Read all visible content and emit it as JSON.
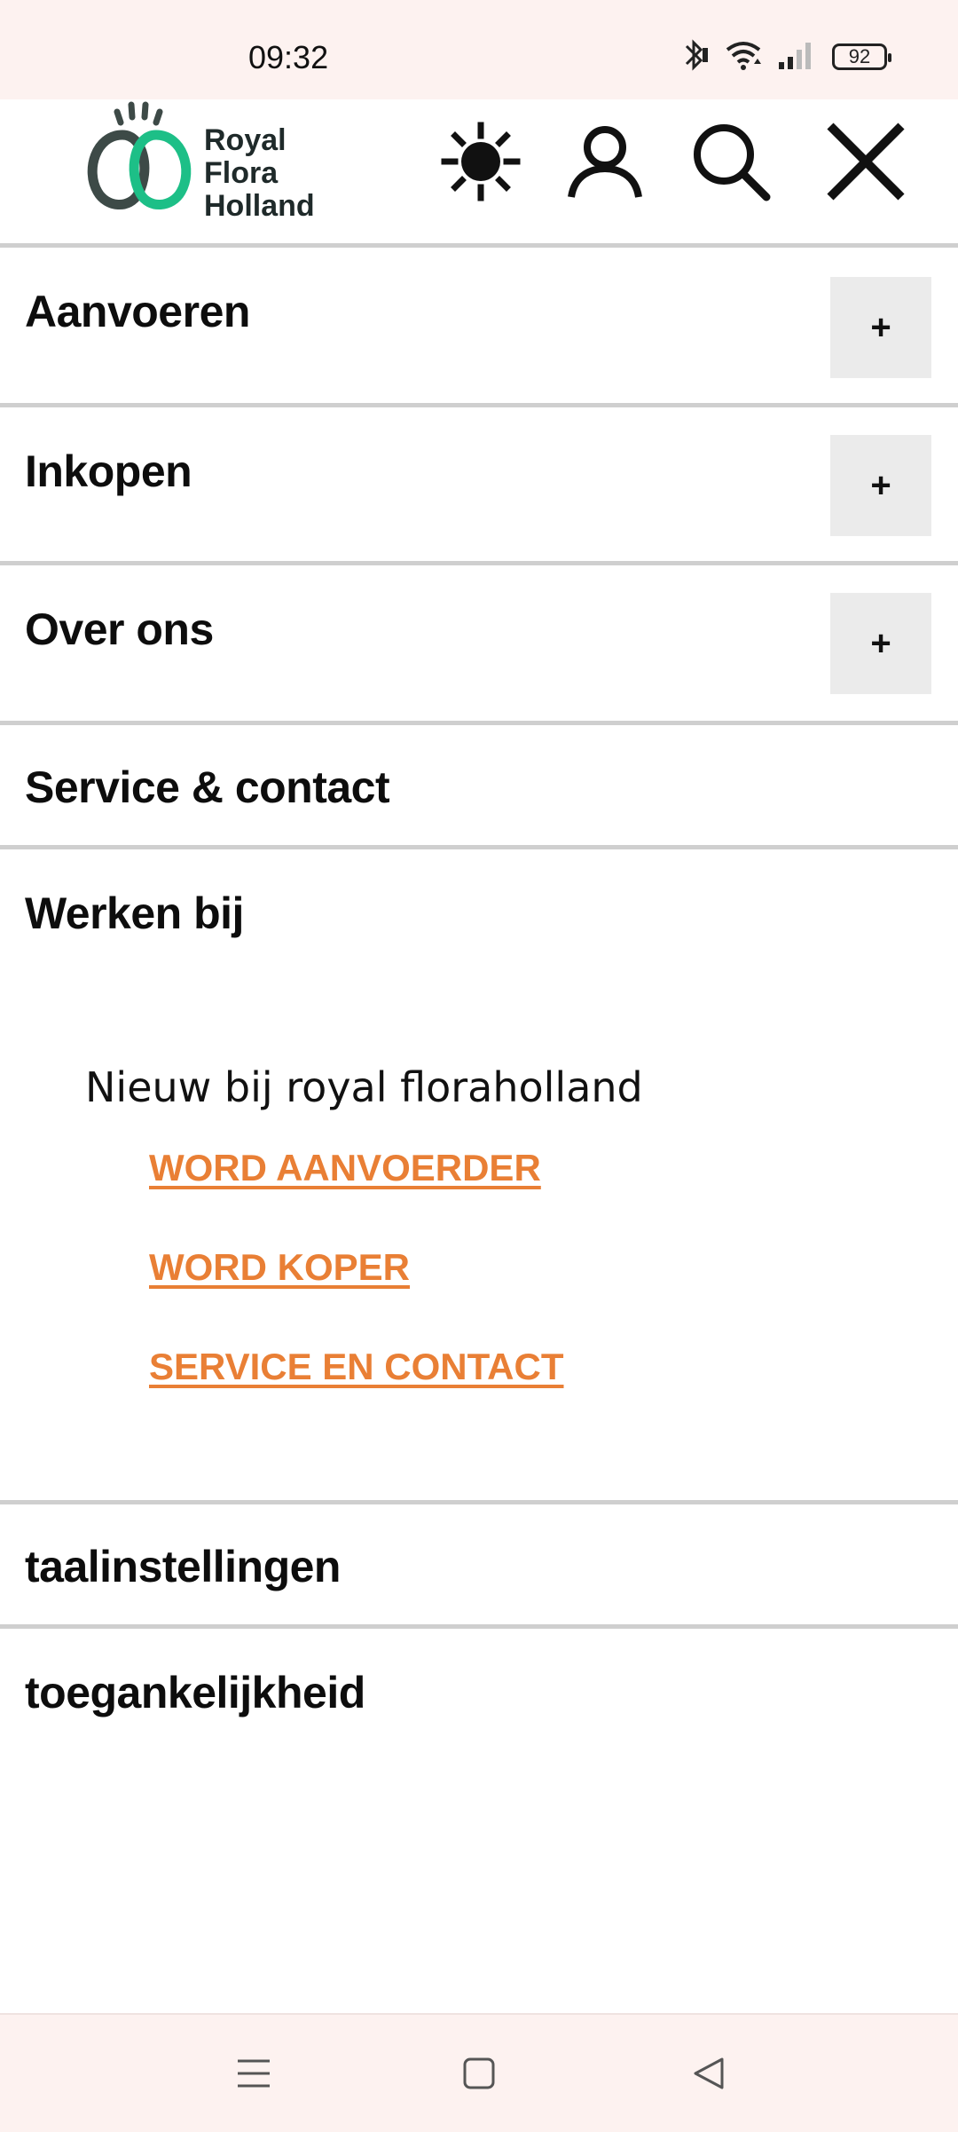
{
  "status_bar": {
    "time": "09:32",
    "battery": "92",
    "icons": [
      "bluetooth-icon",
      "wifi-icon",
      "signal-icon",
      "battery-icon"
    ]
  },
  "header": {
    "logo_lines": [
      "Royal",
      "Flora",
      "Holland"
    ],
    "logo_colors": {
      "dark": "#3d4a47",
      "green": "#1dbf87"
    },
    "icons": [
      "brightness-icon",
      "account-icon",
      "search-icon",
      "close-icon"
    ]
  },
  "menu": {
    "items": [
      {
        "label": "Aanvoeren",
        "expandable": true,
        "toggle": "+"
      },
      {
        "label": "Inkopen",
        "expandable": true,
        "toggle": "+"
      },
      {
        "label": "Over ons",
        "expandable": true,
        "toggle": "+"
      },
      {
        "label": "Service & contact",
        "expandable": false
      },
      {
        "label": "Werken bij",
        "expandable": false
      }
    ],
    "submenu": {
      "heading": "Nieuw bij royal floraholland",
      "links": [
        "WORD AANVOERDER",
        "WORD KOPER",
        "SERVICE EN CONTACT"
      ],
      "link_color": "#e97f35"
    },
    "footer_items": [
      "taalinstellingen",
      "toegankelijkheid"
    ]
  },
  "nav_bar": {
    "buttons": [
      "menu-icon",
      "home-icon",
      "back-icon"
    ]
  }
}
